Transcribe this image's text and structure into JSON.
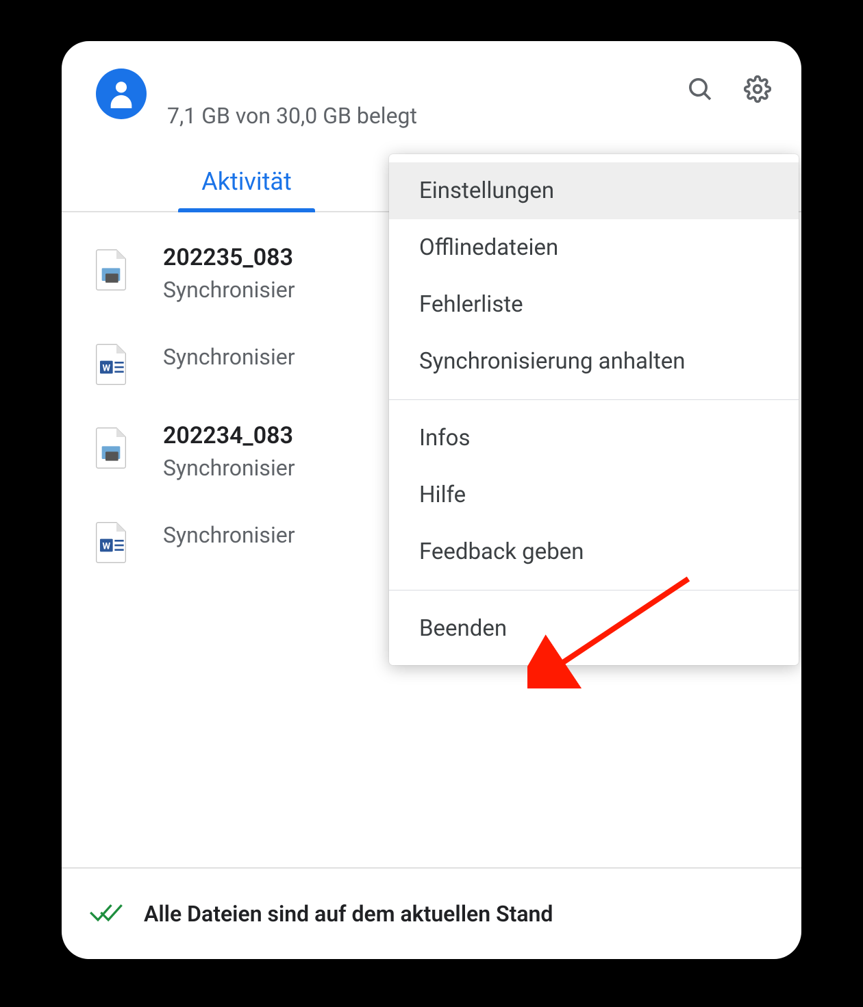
{
  "header": {
    "storage_text": "7,1 GB von 30,0 GB belegt"
  },
  "tabs": {
    "activity_label": "Aktivität"
  },
  "items": [
    {
      "title": "202235_083",
      "status": "Synchronisier",
      "icon": "image"
    },
    {
      "title": "",
      "status": "Synchronisier",
      "icon": "word"
    },
    {
      "title": "202234_083",
      "status": "Synchronisier",
      "icon": "image"
    },
    {
      "title": "",
      "status": "Synchronisier",
      "icon": "word"
    }
  ],
  "footer": {
    "status_text": "Alle Dateien sind auf dem aktuellen Stand"
  },
  "menu": {
    "settings": "Einstellungen",
    "offline": "Offlinedateien",
    "errors": "Fehlerliste",
    "pause": "Synchronisierung anhalten",
    "about": "Infos",
    "help": "Hilfe",
    "feedback": "Feedback geben",
    "quit": "Beenden"
  }
}
